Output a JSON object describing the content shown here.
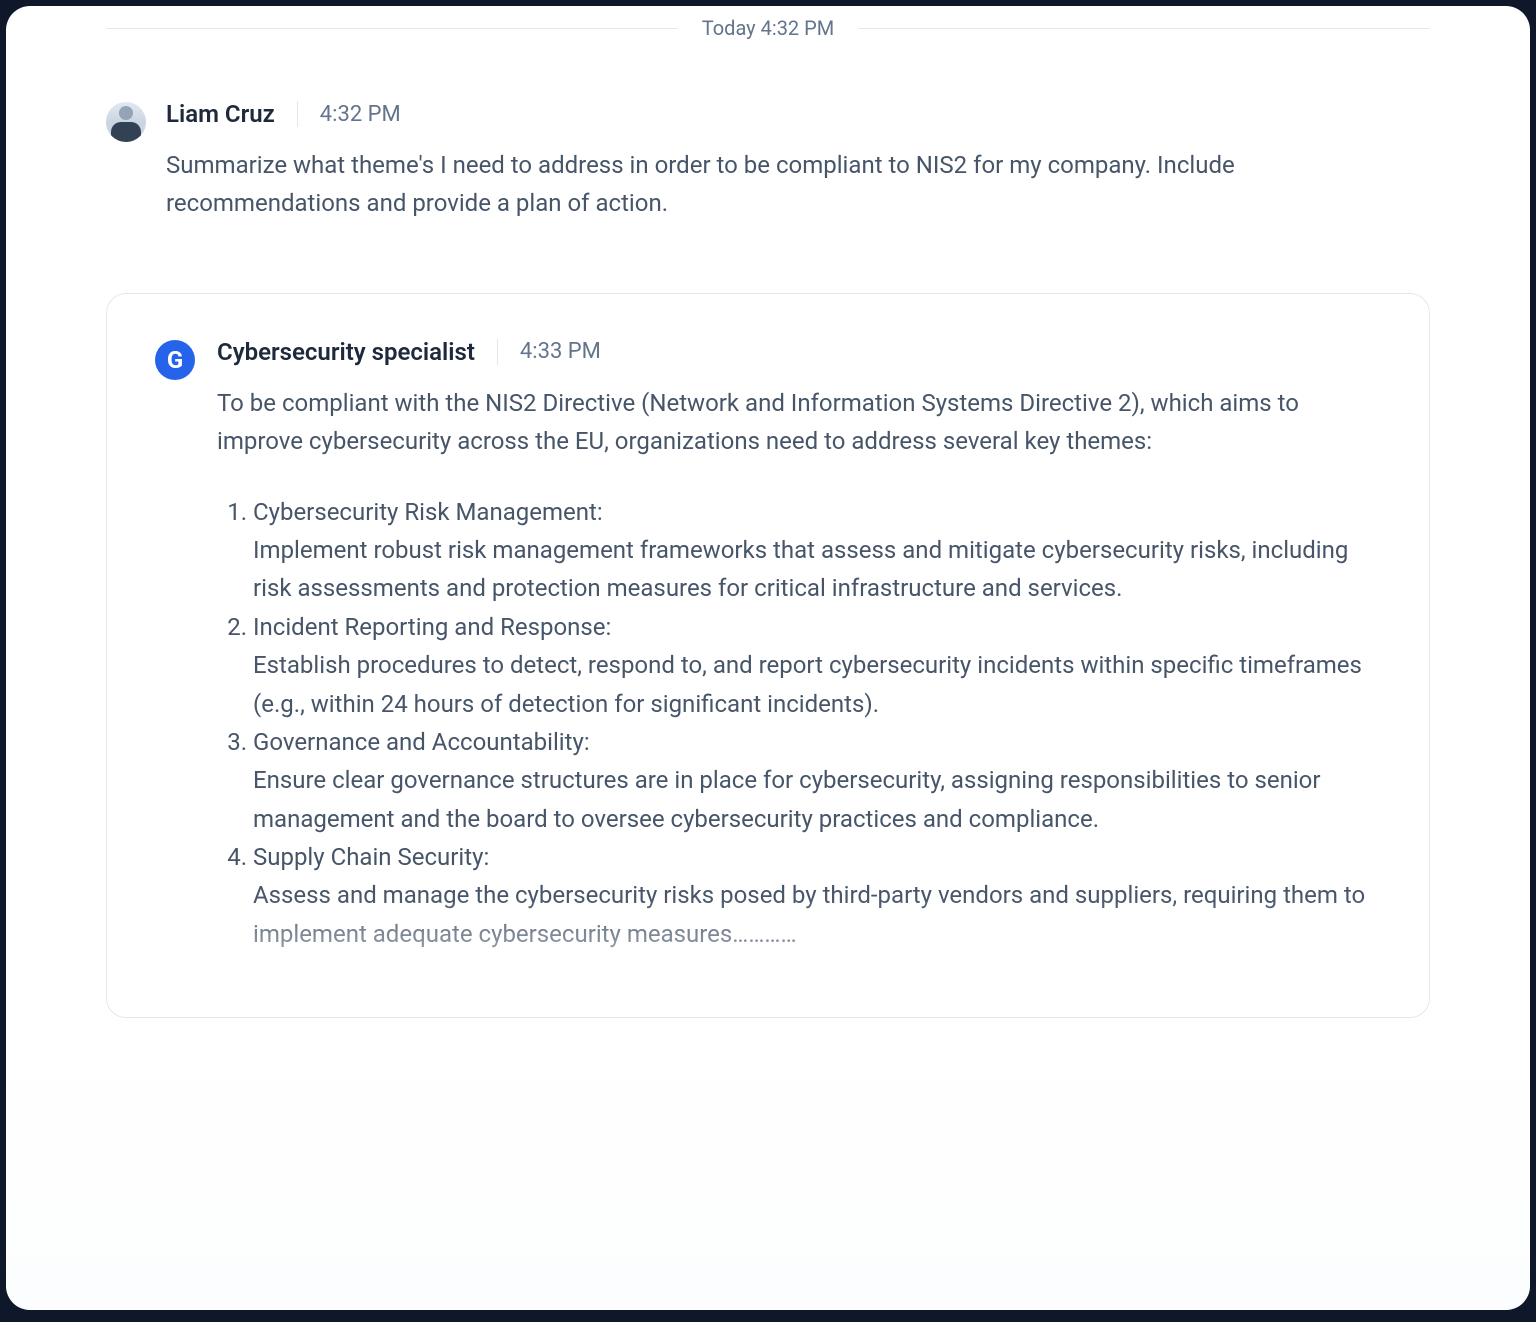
{
  "separator": {
    "label": "Today 4:32 PM"
  },
  "user_message": {
    "sender": "Liam Cruz",
    "time": "4:32 PM",
    "body": "Summarize what theme's I need to address in order to be compliant to NIS2 for my company. Include recommendations and provide a plan of action."
  },
  "bot_message": {
    "sender": "Cybersecurity specialist",
    "avatar_letter": "G",
    "time": "4:33 PM",
    "intro": "To be compliant with the NIS2 Directive (Network and Information Systems Directive 2), which aims to improve cybersecurity across the EU, organizations need to address several key themes:",
    "themes": [
      {
        "title": "Cybersecurity Risk Management:",
        "desc": " Implement robust risk management frameworks that assess and mitigate cybersecurity risks, including risk assessments and protection measures for critical infrastructure and services."
      },
      {
        "title": "Incident Reporting and Response:",
        "desc": " Establish procedures to detect, respond to, and report cybersecurity incidents within specific timeframes (e.g., within 24 hours of detection for significant incidents)."
      },
      {
        "title": "Governance and Accountability:",
        "desc": " Ensure clear governance structures are in place for cybersecurity, assigning responsibilities to senior management and the board to oversee cybersecurity practices and compliance."
      },
      {
        "title": "Supply Chain Security:",
        "desc": " Assess and manage the cybersecurity risks posed by third-party vendors and suppliers, requiring them to implement adequate cybersecurity measures…………"
      }
    ]
  }
}
